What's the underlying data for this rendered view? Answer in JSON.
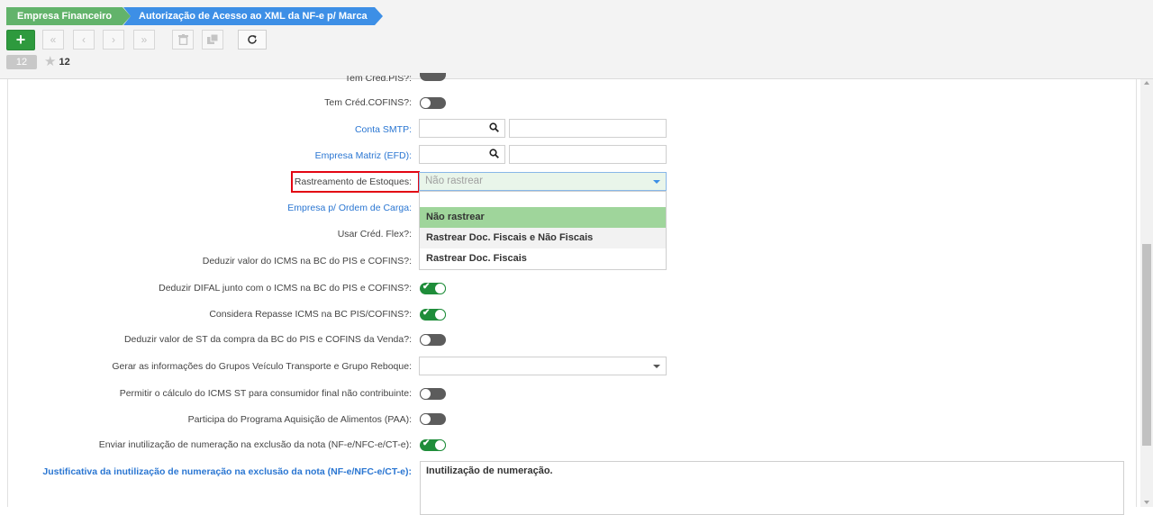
{
  "breadcrumb": [
    "Empresa Financeiro",
    "Autorização de Acesso ao XML da NF-e p/ Marca"
  ],
  "toolbar": {
    "add_label": "+",
    "count": "12",
    "favorites": "12"
  },
  "form": {
    "partial_top_label": "Tem Créd.PIS?:",
    "rows": [
      {
        "label": "Tem Créd.COFINS?:",
        "type": "toggle",
        "on": false
      },
      {
        "label": "Conta SMTP:",
        "type": "lookup"
      },
      {
        "label": "Empresa Matriz (EFD):",
        "type": "lookup"
      },
      {
        "label": "Rastreamento de Estoques:",
        "type": "select"
      },
      {
        "label": "Empresa p/ Ordem de Carga:",
        "type": "lookup"
      },
      {
        "label": "Usar Créd. Flex?:",
        "type": "toggle"
      },
      {
        "label": "Deduzir valor do ICMS na BC do PIS e COFINS?:",
        "type": "toggle"
      },
      {
        "label": "Deduzir DIFAL junto com o ICMS na BC do PIS e COFINS?:",
        "type": "toggle",
        "on": true
      },
      {
        "label": "Considera Repasse ICMS na BC PIS/COFINS?:",
        "type": "toggle",
        "on": true
      },
      {
        "label": "Deduzir valor de ST da compra da BC do PIS e COFINS da Venda?:",
        "type": "toggle",
        "on": false
      },
      {
        "label": "Gerar as informações do Grupos Veículo Transporte e Grupo Reboque:",
        "type": "select"
      },
      {
        "label": "Permitir o cálculo do ICMS ST para consumidor final não contribuinte:",
        "type": "toggle",
        "on": false
      },
      {
        "label": "Participa do Programa Aquisição de Alimentos (PAA):",
        "type": "toggle",
        "on": false
      },
      {
        "label": "Enviar inutilização de numeração na exclusão da nota (NF-e/NFC-e/CT-e):",
        "type": "toggle",
        "on": true
      },
      {
        "label": "Justificativa da inutilização de numeração na exclusão da nota (NF-e/NFC-e/CT-e):",
        "type": "textarea"
      }
    ],
    "stock_tracking": {
      "placeholder": "Não rastrear",
      "options": [
        "Não rastrear",
        "Rastrear Doc. Fiscais e Não Fiscais",
        "Rastrear Doc. Fiscais"
      ],
      "selected": "Não rastrear"
    },
    "justification_value": "Inutilização de numeração."
  },
  "colors": {
    "breadcrumb_first": "#62b36b",
    "breadcrumb_active": "#3d8fe6",
    "add_button": "#2e9a3e",
    "toggle_on": "#1f8d3a",
    "toggle_off": "#5c5c5c",
    "link_label": "#2a76d2",
    "highlight": "#e30613",
    "option_selected": "#9fd59b"
  }
}
